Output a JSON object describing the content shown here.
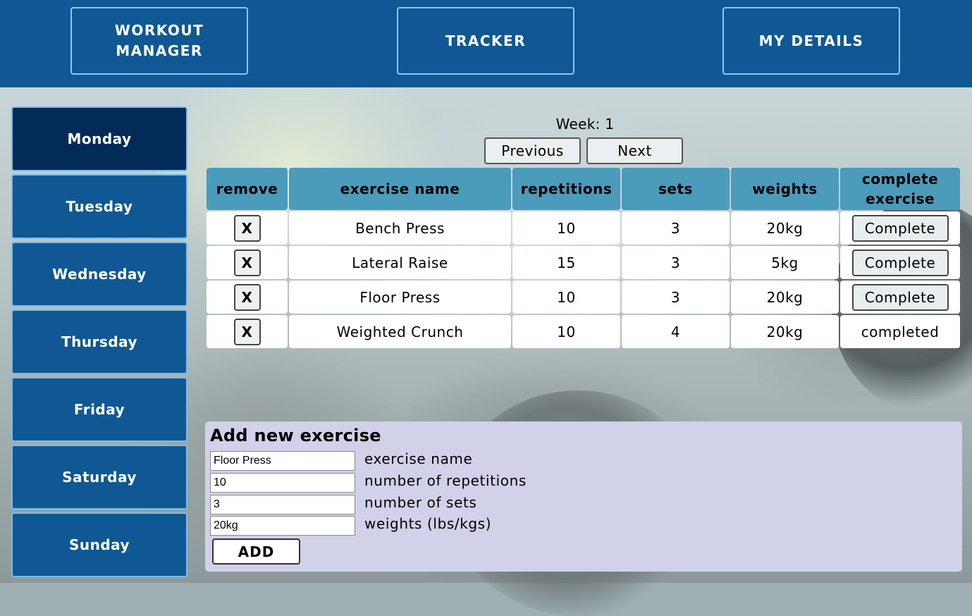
{
  "nav": {
    "workout_manager": "WORKOUT\nMANAGER",
    "tracker": "TRACKER",
    "my_details": "MY DETAILS"
  },
  "days": [
    "Monday",
    "Tuesday",
    "Wednesday",
    "Thursday",
    "Friday",
    "Saturday",
    "Sunday"
  ],
  "active_day": "Monday",
  "week": {
    "label": "Week: 1",
    "previous": "Previous",
    "next": "Next"
  },
  "table": {
    "headers": [
      "remove",
      "exercise name",
      "repetitions",
      "sets",
      "weights",
      "complete exercise"
    ],
    "remove_label": "X",
    "complete_label": "Complete",
    "rows": [
      {
        "name": "Bench Press",
        "reps": "10",
        "sets": "3",
        "weights": "20kg",
        "status": "Complete",
        "done": false
      },
      {
        "name": "Lateral Raise",
        "reps": "15",
        "sets": "3",
        "weights": "5kg",
        "status": "Complete",
        "done": false
      },
      {
        "name": "Floor Press",
        "reps": "10",
        "sets": "3",
        "weights": "20kg",
        "status": "Complete",
        "done": false
      },
      {
        "name": "Weighted Crunch",
        "reps": "10",
        "sets": "4",
        "weights": "20kg",
        "status": "completed",
        "done": true
      }
    ]
  },
  "add_form": {
    "title": "Add new exercise",
    "fields": [
      {
        "value": "Floor Press",
        "label": "exercise name"
      },
      {
        "value": "10",
        "label": "number of repetitions"
      },
      {
        "value": "3",
        "label": "number of sets"
      },
      {
        "value": "20kg",
        "label": "weights (lbs/kgs)"
      }
    ],
    "add_button": "ADD"
  }
}
